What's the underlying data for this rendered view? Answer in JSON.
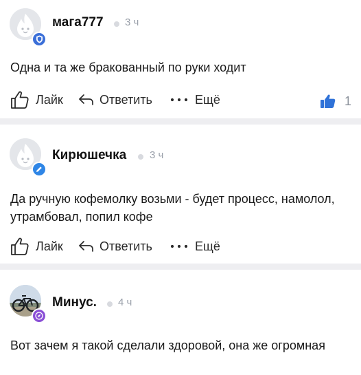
{
  "comments": [
    {
      "username": "мага777",
      "time": "3 ч",
      "text": "Одна и та же бракованный по руки ходит",
      "actions": {
        "like": "Лайк",
        "reply": "Ответить",
        "more": "Ещё"
      },
      "like_count": "1",
      "badge_color": "#3b6fd8",
      "badge_icon": "shield-icon"
    },
    {
      "username": "Кирюшечка",
      "time": "3 ч",
      "text": "Да ручную кофемолку возьми - будет процесс, намолол, утрамбовал, попил кофе",
      "actions": {
        "like": "Лайк",
        "reply": "Ответить",
        "more": "Ещё"
      },
      "badge_color": "#2f86e6",
      "badge_icon": "pencil-icon"
    },
    {
      "username": "Минус.",
      "time": "4 ч",
      "text": "Вот зачем я такой сделали здоровой, она же огромная",
      "badge_color": "#8a4fd6",
      "badge_icon": "compass-icon"
    }
  ],
  "colors": {
    "like_active": "#2f72d8",
    "divider": "#eeeef1",
    "muted": "#9aa0aa"
  }
}
